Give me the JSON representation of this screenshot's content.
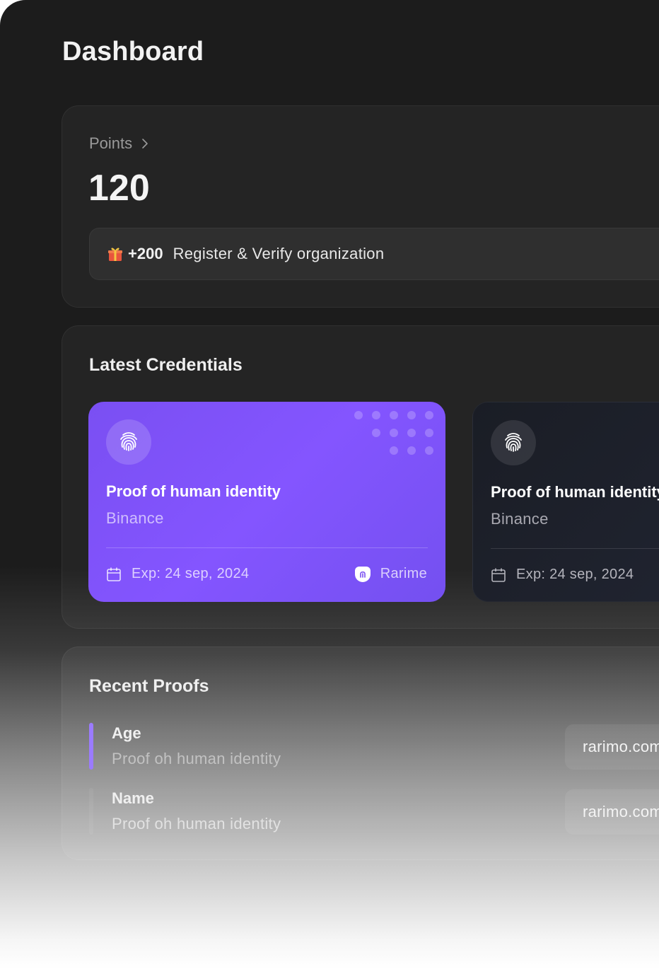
{
  "page": {
    "title": "Dashboard"
  },
  "points": {
    "label": "Points",
    "value": "120",
    "reward": {
      "icon": "gift-icon",
      "amount": "+200",
      "text": "Register & Verify organization"
    }
  },
  "credentials": {
    "title": "Latest Credentials",
    "cards": [
      {
        "icon": "fingerprint-icon",
        "title": "Proof of human identity",
        "issuer": "Binance",
        "expiry": "Exp: 24 sep, 2024",
        "brand": "Rarime",
        "style": "purple"
      },
      {
        "icon": "fingerprint-icon",
        "title": "Proof of human identity",
        "issuer": "Binance",
        "expiry": "Exp: 24 sep, 2024",
        "style": "dark"
      }
    ]
  },
  "proofs": {
    "title": "Recent Proofs",
    "items": [
      {
        "name": "Age",
        "description": "Proof oh human identity",
        "domain": "rarimo.com",
        "accent": "#9b7bff"
      },
      {
        "name": "Name",
        "description": "Proof oh human identity",
        "domain": "rarimo.com",
        "accent": "#b0b0b0"
      }
    ]
  },
  "colors": {
    "accent_purple": "#8455ff",
    "background": "#1c1c1c"
  }
}
